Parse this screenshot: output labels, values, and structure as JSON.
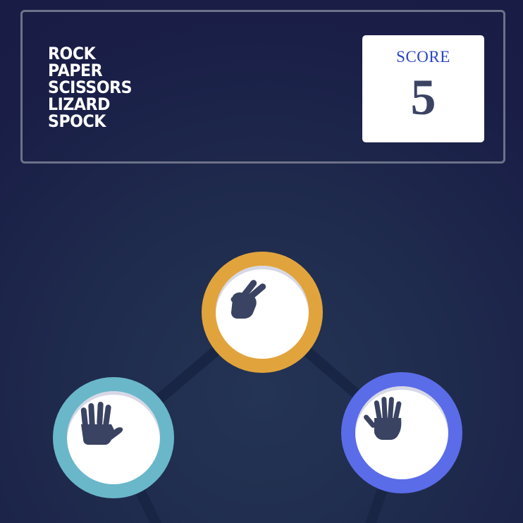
{
  "header": {
    "title_lines": [
      "ROCK",
      "PAPER",
      "SCISSORS",
      "LIZARD",
      "SPOCK"
    ],
    "score_label": "SCORE",
    "score_value": "5"
  },
  "choices": [
    {
      "name": "scissors",
      "icon": "scissors-hand-icon",
      "color": "#e1a43c"
    },
    {
      "name": "spock",
      "icon": "spock-hand-icon",
      "color": "#6ab7ca"
    },
    {
      "name": "paper",
      "icon": "paper-hand-icon",
      "color": "#5b6ce9"
    }
  ],
  "colors": {
    "background": "#1f2b4d",
    "header_border": "#6c7288",
    "score_label": "#2a45c2",
    "score_value": "#3b4363",
    "hand_icon": "#3b4363",
    "pentagon_line": "#192544"
  }
}
